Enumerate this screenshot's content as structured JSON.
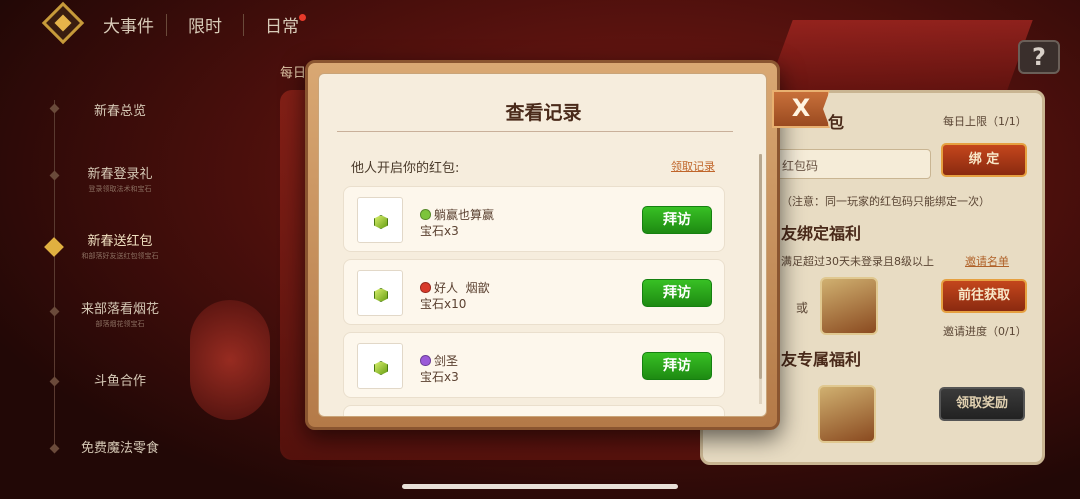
{
  "top_tabs": [
    {
      "label": "大事件"
    },
    {
      "label": "限时"
    },
    {
      "label": "日常",
      "has_badge": true
    }
  ],
  "bg_hint": "每日",
  "help_label": "?",
  "sidebar": {
    "items": [
      {
        "label": "新春总览",
        "sub": ""
      },
      {
        "label": "新春登录礼",
        "sub": "登录领取法术和宝石"
      },
      {
        "label": "新春送红包",
        "sub": "和部落好友送红包领宝石",
        "active": true
      },
      {
        "label": "来部落看烟花",
        "sub": "部落烟花领宝石"
      },
      {
        "label": "斗鱼合作",
        "sub": ""
      },
      {
        "label": "免费魔法零食",
        "sub": ""
      }
    ]
  },
  "right_panel": {
    "title_fragment": "包",
    "daily_limit": "每日上限（1/1）",
    "code_placeholder": "红包码",
    "bind_button": "绑 定",
    "note": "（注意：同一玩家的红包码只能绑定一次）",
    "bind_welfare_title": "友绑定福利",
    "requirement": "满足超过30天未登录且8级以上",
    "invite_list": "邀请名单",
    "or": "或",
    "go_button": "前往获取",
    "invite_progress": "邀请进度（0/1）",
    "exclusive_title": "友专属福利",
    "claim_button": "领取奖励"
  },
  "modal": {
    "title": "查看记录",
    "section_label": "他人开启你的红包:",
    "claim_record_link": "领取记录",
    "close_label": "X",
    "records": [
      {
        "league_color": "#7cc43a",
        "player": "躺赢也算赢",
        "reward": "宝石x3",
        "button": "拜访"
      },
      {
        "league_color": "#d83a2a",
        "player": "好人  烟歆",
        "reward": "宝石x10",
        "button": "拜访"
      },
      {
        "league_color": "#9a5ad8",
        "player": "剑圣",
        "reward": "宝石x3",
        "button": "拜访"
      }
    ]
  }
}
